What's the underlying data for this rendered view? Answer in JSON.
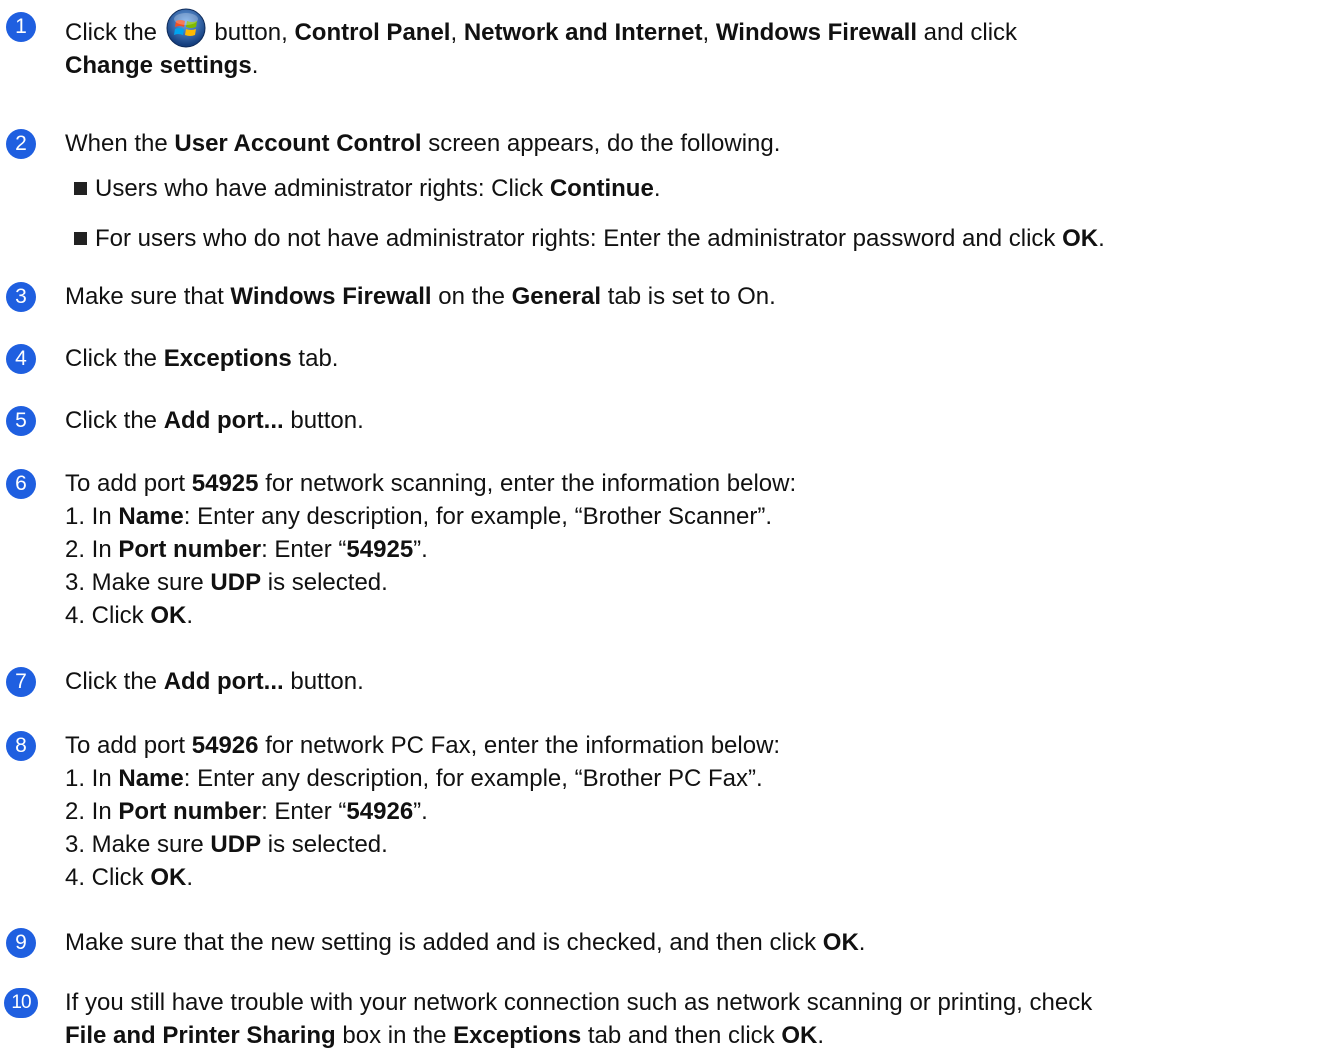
{
  "steps": {
    "s1": {
      "number": "1",
      "a": "Click the",
      "b": "button,",
      "c": "Control Panel",
      "d": ",",
      "e": "Network and Internet",
      "f": ",",
      "g": "Windows Firewall",
      "h": "and click",
      "i": "Change settings",
      "j": "."
    },
    "s2": {
      "number": "2",
      "a": "When the",
      "b": "User Account Control",
      "c": "screen appears, do the following.",
      "bullets": [
        {
          "a": "Users who have administrator rights: Click",
          "b": "Continue",
          "c": "."
        },
        {
          "a": "For users who do not have administrator rights: Enter the administrator password and click",
          "b": "OK",
          "c": "."
        }
      ]
    },
    "s3": {
      "number": "3",
      "a": "Make sure that",
      "b": "Windows Firewall",
      "c": "on the",
      "d": "General",
      "e": "tab is set to On."
    },
    "s4": {
      "number": "4",
      "a": "Click the",
      "b": "Exceptions",
      "c": "tab."
    },
    "s5": {
      "number": "5",
      "a": "Click the",
      "b": "Add port...",
      "c": "button."
    },
    "s6": {
      "number": "6",
      "a": "To add port",
      "b": "54925",
      "c": "for network scanning, enter the information below:",
      "l1a": "1. In",
      "l1b": "Name",
      "l1c": ": Enter any description, for example, “Brother Scanner”.",
      "l2a": "2. In",
      "l2b": "Port number",
      "l2c": ": Enter “",
      "l2d": "54925",
      "l2e": "”.",
      "l3a": "3. Make sure",
      "l3b": "UDP",
      "l3c": "is selected.",
      "l4a": "4. Click",
      "l4b": "OK",
      "l4c": "."
    },
    "s7": {
      "number": "7",
      "a": "Click the",
      "b": "Add port...",
      "c": "button."
    },
    "s8": {
      "number": "8",
      "a": "To add port",
      "b": "54926",
      "c": "for network PC Fax, enter the information below:",
      "l1a": "1. In",
      "l1b": "Name",
      "l1c": ": Enter any description, for example, “Brother PC Fax”.",
      "l2a": "2. In",
      "l2b": "Port number",
      "l2c": ": Enter “",
      "l2d": "54926",
      "l2e": "”.",
      "l3a": "3. Make sure",
      "l3b": "UDP",
      "l3c": "is selected.",
      "l4a": "4. Click",
      "l4b": "OK",
      "l4c": "."
    },
    "s9": {
      "number": "9",
      "a": "Make sure that the new setting is added and is checked, and then click",
      "b": "OK",
      "c": "."
    },
    "s10": {
      "number": "10",
      "a": "If you still have trouble with your network connection such as network scanning or printing, check",
      "b": "File and Printer Sharing",
      "c": "box in the",
      "d": "Exceptions",
      "e": "tab and then click",
      "f": "OK",
      "g": "."
    }
  },
  "icons": {
    "start_button": "windows-start-orb-icon",
    "bullet": "square-bullet-icon"
  },
  "colors": {
    "step_badge": "#1f5fe0",
    "text": "#111111"
  }
}
